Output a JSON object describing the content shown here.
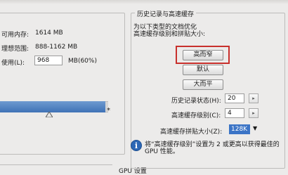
{
  "memory": {
    "available_label": "可用内存:",
    "available_value": "1614 MB",
    "ideal_range_label": "理想范围:",
    "ideal_range_value": "888-1162 MB",
    "use_label": "使用(L):",
    "use_value": "968",
    "use_suffix": "MB(60%)",
    "slider_marker": "*",
    "slider_fraction": 0.6
  },
  "history_cache": {
    "group_title": "历史记录与高速缓存",
    "description_line1": "为以下类型的文档优化",
    "description_line2": "高速缓存级别和拼贴大小:",
    "button_tall_thin": "高而窄",
    "button_default": "默认",
    "button_big_flat": "大而平",
    "history_states_label": "历史记录状态(H):",
    "history_states_value": "20",
    "cache_levels_label": "高速缓存级别(C):",
    "cache_levels_value": "4",
    "cache_tile_label": "高速缓存拼贴大小(Z):",
    "cache_tile_value": "128K",
    "info_line1": "将“高速缓存级别”设置为 2 或更高以获得最佳的",
    "info_line2": "GPU 性能。"
  },
  "gpu": {
    "group_title": "GPU 设置"
  },
  "colors": {
    "highlight_border": "#c8302c",
    "selection_blue": "#3b74c6",
    "slider_blue": "#4a7dc0",
    "info_icon_blue": "#2c67b5"
  }
}
